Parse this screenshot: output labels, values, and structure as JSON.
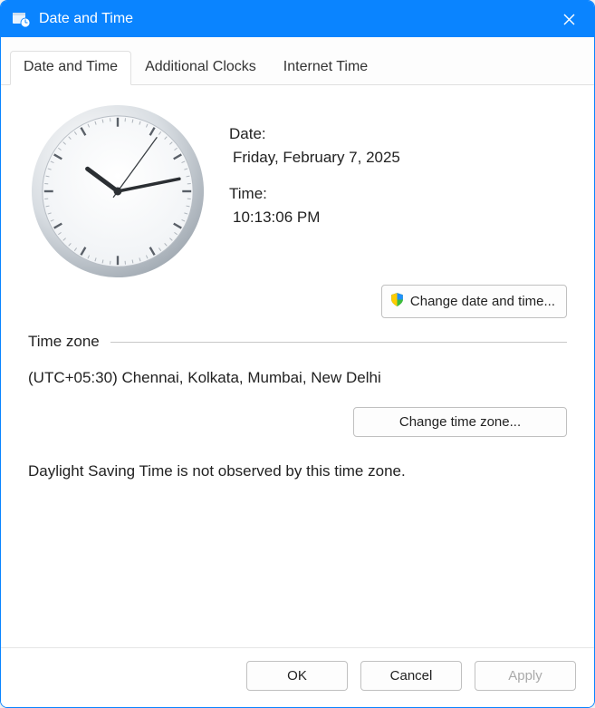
{
  "titlebar": {
    "title": "Date and Time"
  },
  "tabs": {
    "t0": "Date and Time",
    "t1": "Additional Clocks",
    "t2": "Internet Time"
  },
  "date_section": {
    "label": "Date:",
    "value": "Friday, February 7, 2025"
  },
  "time_section": {
    "label": "Time:",
    "value": "10:13:06 PM"
  },
  "buttons": {
    "change_datetime": "Change date and time...",
    "change_tz": "Change time zone...",
    "ok": "OK",
    "cancel": "Cancel",
    "apply": "Apply"
  },
  "timezone": {
    "heading": "Time zone",
    "value": "(UTC+05:30) Chennai, Kolkata, Mumbai, New Delhi"
  },
  "dst_note": "Daylight Saving Time is not observed by this time zone.",
  "clock": {
    "hour": 10,
    "minute": 13,
    "second": 6,
    "pm": true
  }
}
